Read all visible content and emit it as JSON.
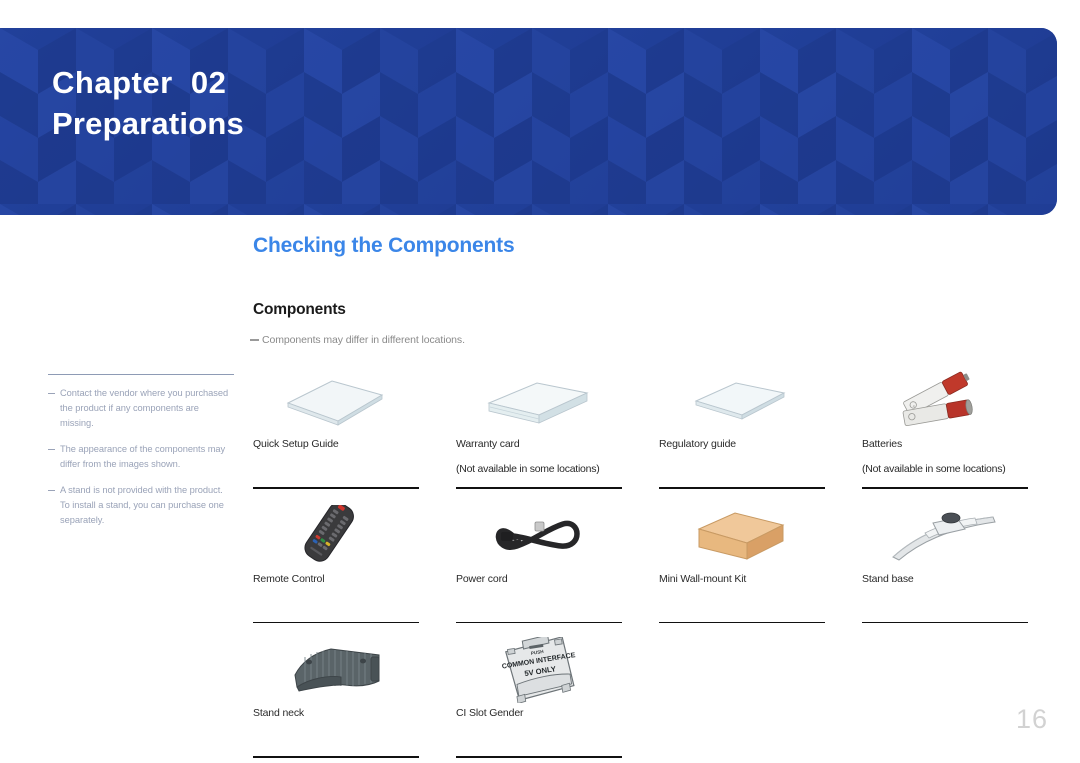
{
  "document": {
    "page_number": "16",
    "accent_blue": "#3B86E8",
    "banner_blue": "#21409A"
  },
  "banner": {
    "chapter_label": "Chapter  02",
    "chapter_title": "Preparations"
  },
  "section": {
    "title": "Checking the Components",
    "subtitle": "Components",
    "note": "Components may differ in different locations."
  },
  "sidebar": {
    "notes": [
      "Contact the vendor where you purchased the product if any components are missing.",
      "The appearance of the components may differ from the images shown.",
      "A stand is not provided with the product. To install a stand, you can purchase one separately."
    ]
  },
  "components": {
    "rows": [
      [
        {
          "icon": "quick-setup-guide-icon",
          "label": "Quick Setup Guide",
          "sublabel": ""
        },
        {
          "icon": "warranty-card-icon",
          "label": "Warranty card",
          "sublabel": "(Not available in some locations)"
        },
        {
          "icon": "regulatory-guide-icon",
          "label": "Regulatory guide",
          "sublabel": ""
        },
        {
          "icon": "batteries-icon",
          "label": "Batteries",
          "sublabel": "(Not available in some locations)"
        }
      ],
      [
        {
          "icon": "remote-control-icon",
          "label": "Remote Control",
          "sublabel": ""
        },
        {
          "icon": "power-cord-icon",
          "label": "Power cord",
          "sublabel": ""
        },
        {
          "icon": "mini-wall-mount-kit-icon",
          "label": "Mini Wall-mount Kit",
          "sublabel": ""
        },
        {
          "icon": "stand-base-icon",
          "label": "Stand base",
          "sublabel": ""
        }
      ],
      [
        {
          "icon": "stand-neck-icon",
          "label": "Stand neck",
          "sublabel": ""
        },
        {
          "icon": "ci-slot-gender-icon",
          "label": "CI Slot Gender",
          "sublabel": ""
        }
      ]
    ]
  },
  "ci_slot_gender_art": {
    "line1": "PUSH",
    "line2": "COMMON INTERFACE",
    "line3": "5V ONLY"
  }
}
